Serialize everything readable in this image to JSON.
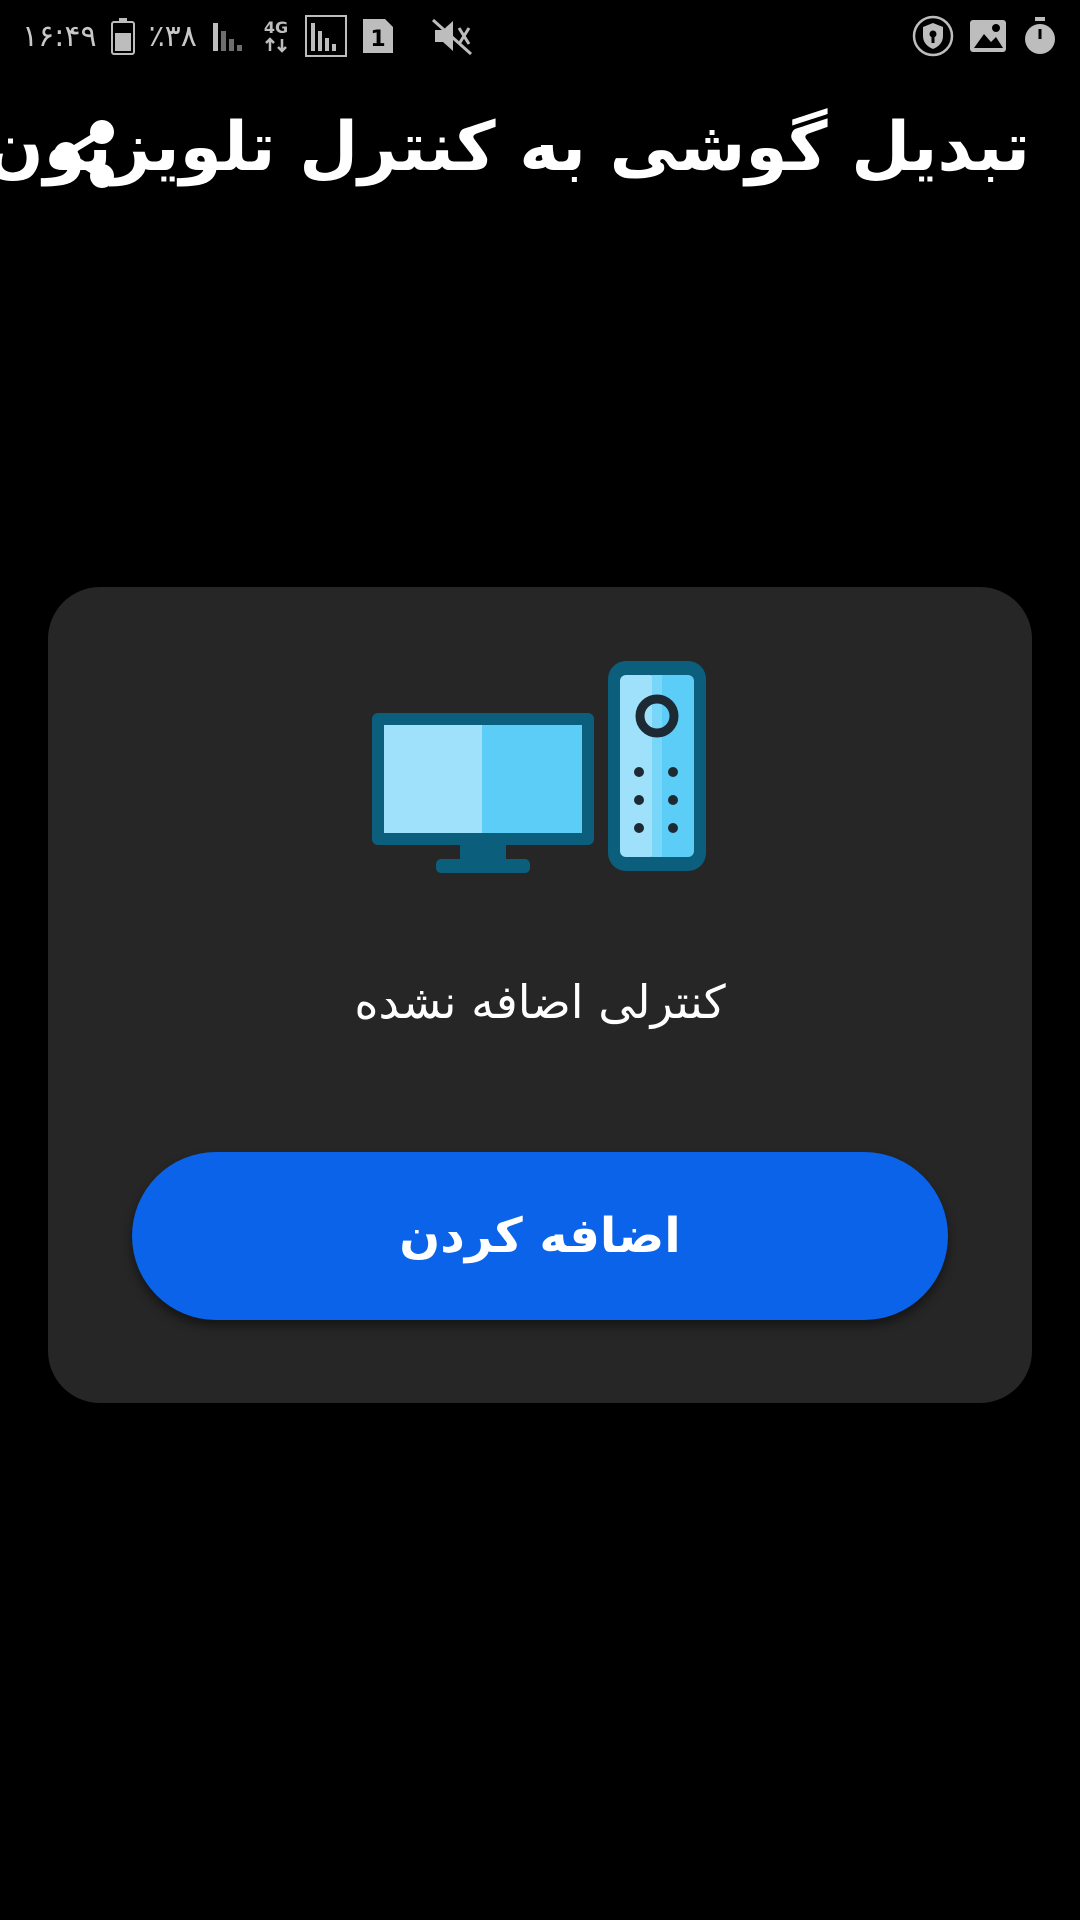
{
  "status_bar": {
    "time": "۱۶:۴۹",
    "battery_percent": "٪۳۸",
    "network": "4G",
    "sim_slot": "1",
    "icons_left": [
      "battery-icon",
      "signal-icon",
      "network-4g-icon",
      "signal-full-icon",
      "sim-1-icon",
      "mute-icon"
    ],
    "icons_right": [
      "shield-icon",
      "gallery-icon",
      "timer-icon"
    ]
  },
  "header": {
    "title": "تبدیل گوشی به کنترل تلویزیون",
    "share_icon": "share-icon"
  },
  "card": {
    "illustration_icon": "tv-remote-icon",
    "empty_message": "کنترلی اضافه نشده",
    "add_button_label": "اضافه کردن"
  },
  "colors": {
    "background": "#000000",
    "card": "#262626",
    "accent": "#0a63e8",
    "tv_light": "#9fe0fb",
    "tv_mid": "#5ccdf6",
    "tv_dark": "#0b5f7c"
  }
}
